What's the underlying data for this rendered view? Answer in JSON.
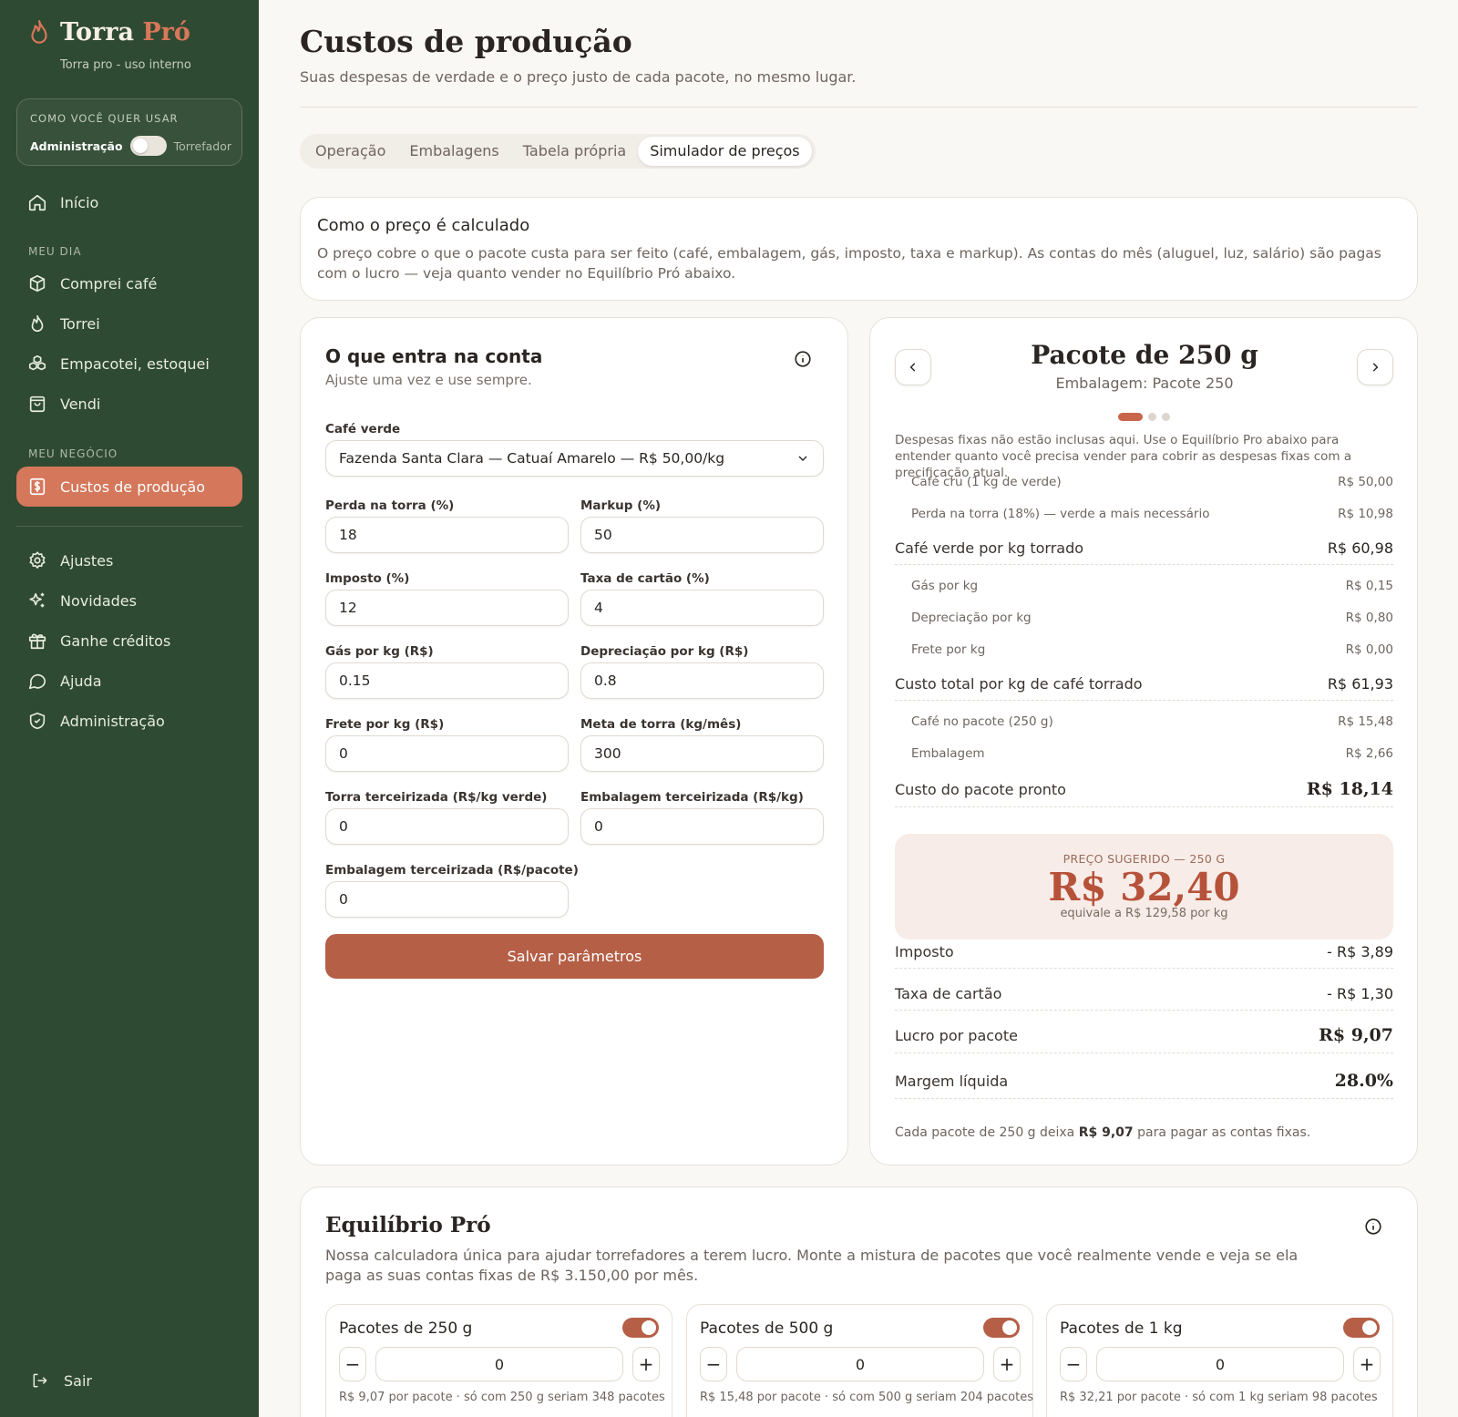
{
  "sidebar": {
    "brand_main": "Torra",
    "brand_accent": "Pró",
    "brand_sub": "Torra pro - uso interno",
    "mode_label": "COMO VOCÊ QUER USAR",
    "mode_option_a": "Administração",
    "mode_option_b": "Torrefador",
    "home": "Início",
    "section_day": "MEU DIA",
    "day_items": [
      "Comprei café",
      "Torrei",
      "Empacotei, estoquei",
      "Vendi"
    ],
    "section_business": "MEU NEGÓCIO",
    "business_active": "Custos de produção",
    "bottom_items": [
      "Ajustes",
      "Novidades",
      "Ganhe créditos",
      "Ajuda",
      "Administração"
    ],
    "logout": "Sair"
  },
  "header": {
    "title": "Custos de produção",
    "subtitle": "Suas despesas de verdade e o preço justo de cada pacote, no mesmo lugar.",
    "tabs": [
      "Operação",
      "Embalagens",
      "Tabela própria",
      "Simulador de preços"
    ],
    "active_tab": "Simulador de preços"
  },
  "info": {
    "title": "Como o preço é calculado",
    "text": "O preço cobre o que o pacote custa para ser feito (café, embalagem, gás, imposto, taxa e markup). As contas do mês (aluguel, luz, salário) são pagas com o lucro — veja quanto vender no Equilíbrio Pró abaixo."
  },
  "params": {
    "title": "O que entra na conta",
    "subtitle": "Ajuste uma vez e use sempre.",
    "coffee_label": "Café verde",
    "coffee_value": "Fazenda Santa Clara — Catuaí Amarelo — R$ 50,00/kg",
    "fields": [
      {
        "label": "Perda na torra (%)",
        "value": "18"
      },
      {
        "label": "Markup (%)",
        "value": "50"
      },
      {
        "label": "Imposto (%)",
        "value": "12"
      },
      {
        "label": "Taxa de cartão (%)",
        "value": "4"
      },
      {
        "label": "Gás por kg (R$)",
        "value": "0.15"
      },
      {
        "label": "Depreciação por kg (R$)",
        "value": "0.8"
      },
      {
        "label": "Frete por kg (R$)",
        "value": "0"
      },
      {
        "label": "Meta de torra (kg/mês)",
        "value": "300"
      },
      {
        "label": "Torra terceirizada (R$/kg verde)",
        "value": "0"
      },
      {
        "label": "Embalagem terceirizada (R$/kg)",
        "value": "0"
      },
      {
        "label": "Embalagem terceirizada (R$/pacote)",
        "value": "0"
      }
    ],
    "save": "Salvar parâmetros"
  },
  "package": {
    "title": "Pacote de 250 g",
    "subtitle": "Embalagem: Pacote 250",
    "note": "Despesas fixas não estão inclusas aqui. Use o Equilíbrio Pro abaixo para entender quanto você precisa vender para cobrir as despesas fixas com a precificação atual.",
    "rows": {
      "cafe_cru": {
        "label": "Café cru (1 kg de verde)",
        "value": "R$ 50,00"
      },
      "perda": {
        "label": "Perda na torra (18%) — verde a mais necessário",
        "value": "R$ 10,98"
      },
      "cafe_verde_kg": {
        "label": "Café verde por kg torrado",
        "value": "R$ 60,98"
      },
      "gas": {
        "label": "Gás por kg",
        "value": "R$ 0,15"
      },
      "depreciacao": {
        "label": "Depreciação por kg",
        "value": "R$ 0,80"
      },
      "frete": {
        "label": "Frete por kg",
        "value": "R$ 0,00"
      },
      "custo_total_kg": {
        "label": "Custo total por kg de café torrado",
        "value": "R$ 61,93"
      },
      "cafe_pacote": {
        "label": "Café no pacote (250 g)",
        "value": "R$ 15,48"
      },
      "embalagem": {
        "label": "Embalagem",
        "value": "R$ 2,66"
      },
      "custo_pacote": {
        "label": "Custo do pacote pronto",
        "value": "R$ 18,14"
      },
      "imposto": {
        "label": "Imposto",
        "value": "- R$ 3,89"
      },
      "taxa": {
        "label": "Taxa de cartão",
        "value": "- R$ 1,30"
      },
      "lucro": {
        "label": "Lucro por pacote",
        "value": "R$ 9,07"
      },
      "margem": {
        "label": "Margem líquida",
        "value": "28.0%"
      }
    },
    "suggested_label": "PREÇO SUGERIDO — 250 G",
    "suggested_price": "R$ 32,40",
    "suggested_per_kg": "equivale a R$ 129,58 por kg",
    "footer_pre": "Cada pacote de 250 g deixa",
    "footer_value": "R$ 9,07",
    "footer_post": "para pagar as contas fixas."
  },
  "equilibrio": {
    "title": "Equilíbrio Pró",
    "text": "Nossa calculadora única para ajudar torrefadores a terem lucro. Monte a mistura de pacotes que você realmente vende e veja se ela paga as suas contas fixas de R$ 3.150,00 por mês.",
    "packs": [
      {
        "name": "Pacotes de 250 g",
        "qty": "0",
        "note": "R$ 9,07 por pacote · só com 250 g seriam 348 pacotes"
      },
      {
        "name": "Pacotes de 500 g",
        "qty": "0",
        "note": "R$ 15,48 por pacote · só com 500 g seriam 204 pacotes"
      },
      {
        "name": "Pacotes de 1 kg",
        "qty": "0",
        "note": "R$ 32,21 por pacote · só com 1 kg seriam 98 pacotes"
      }
    ]
  }
}
